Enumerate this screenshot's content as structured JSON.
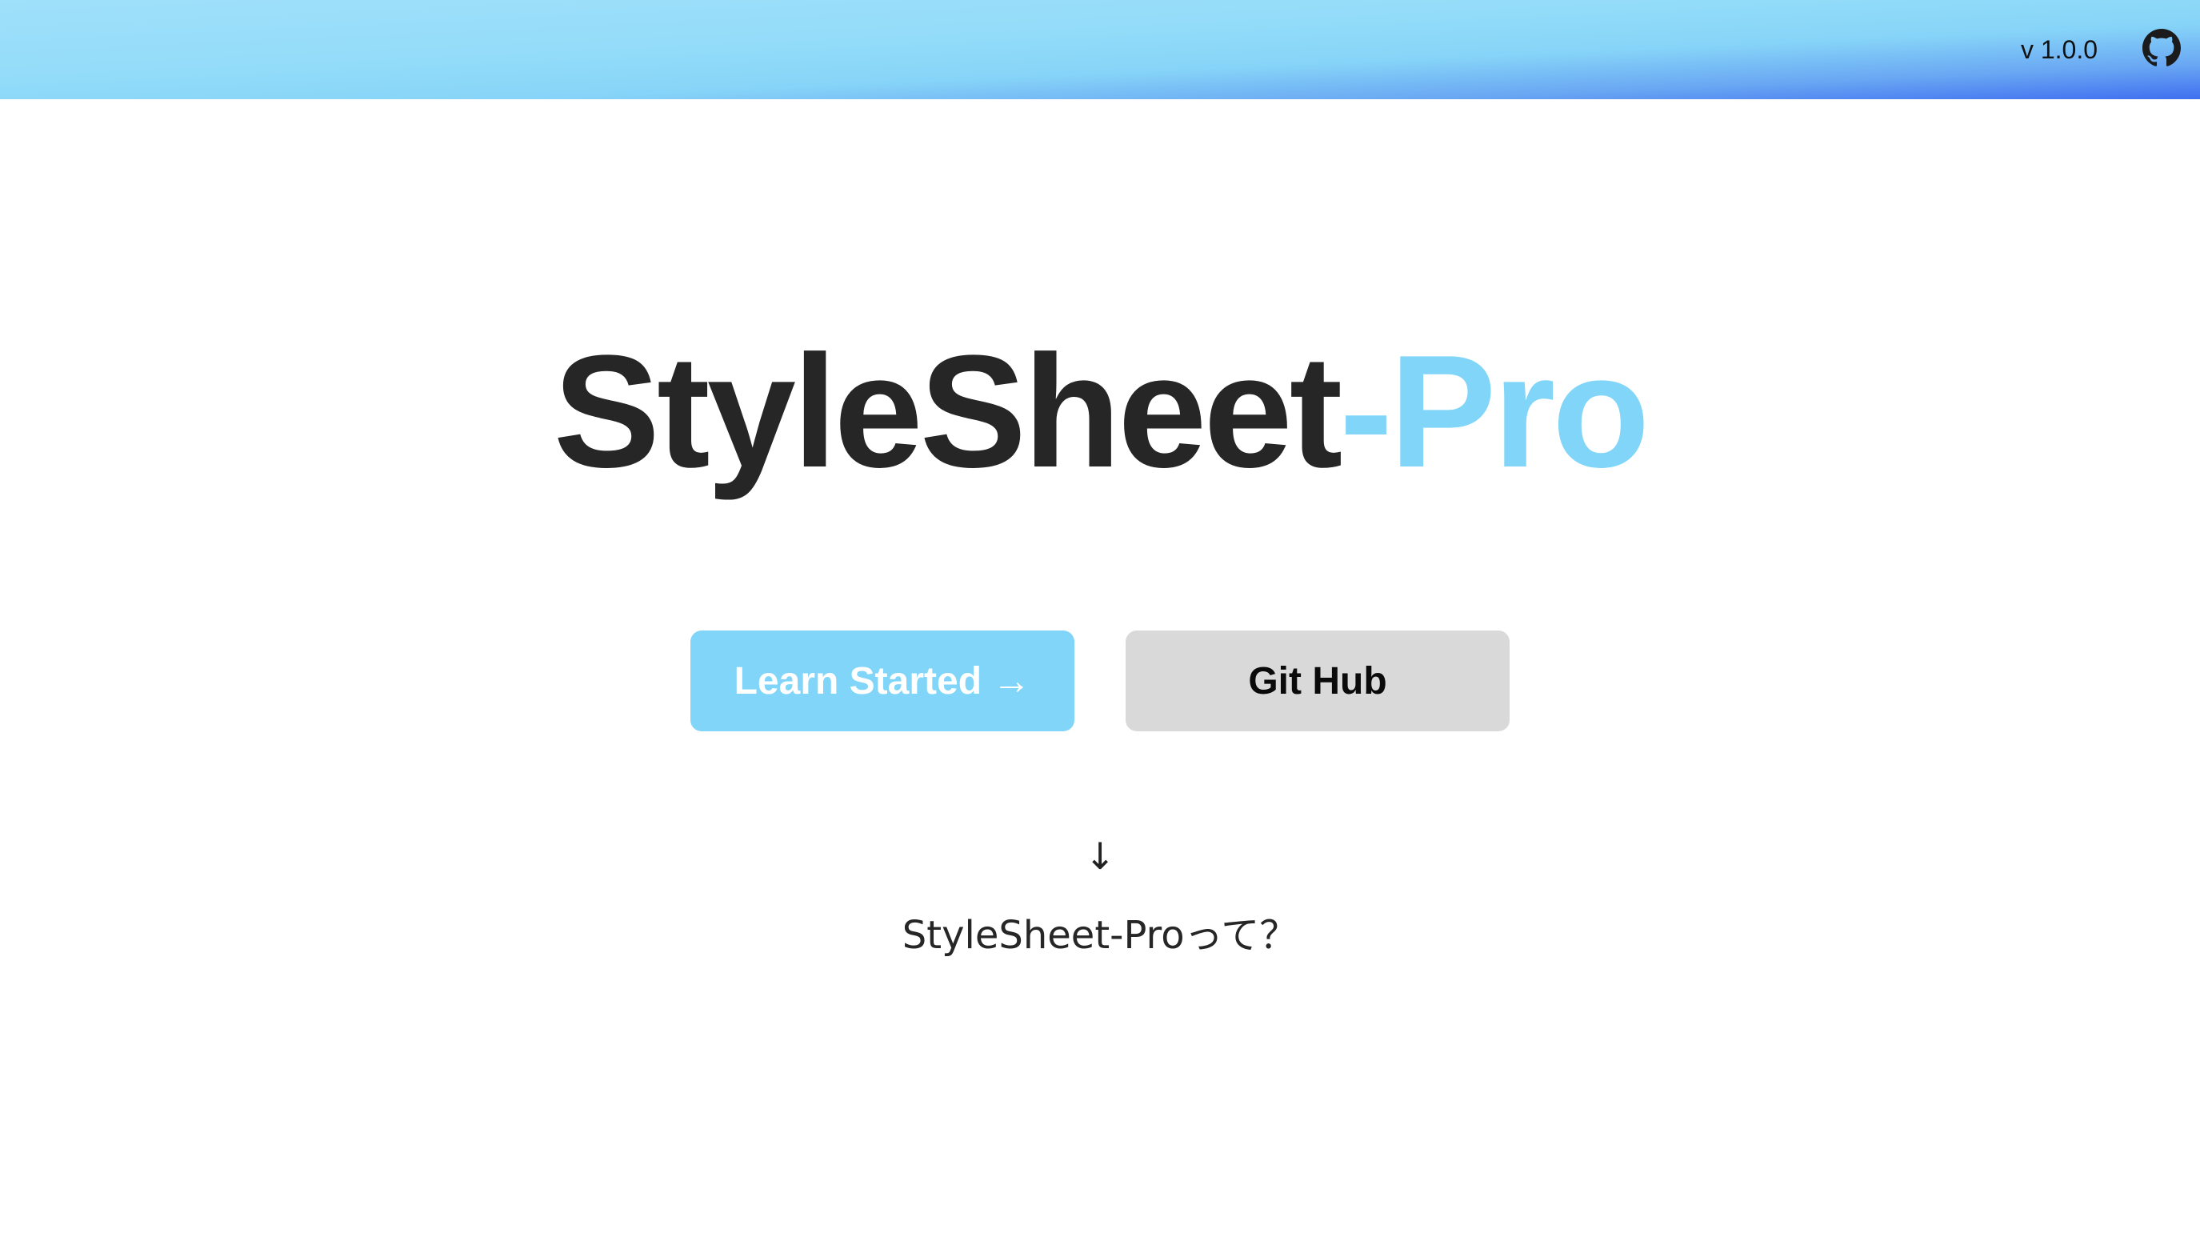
{
  "header": {
    "version": "v 1.0.0",
    "github_icon": "github-icon"
  },
  "hero": {
    "title_main": "StyleSheet",
    "title_accent": "-Pro"
  },
  "buttons": {
    "primary_label": "Learn Started →",
    "secondary_label": "Git Hub"
  },
  "scroll_hint": {
    "arrow": "↓",
    "label": "StyleSheet-Proって？"
  },
  "colors": {
    "accent": "#80d5f8",
    "title": "#262626",
    "secondary_button": "#d9d9d9",
    "header_gradient_start": "#9fe0fa",
    "header_gradient_end": "#3f6ff0"
  }
}
